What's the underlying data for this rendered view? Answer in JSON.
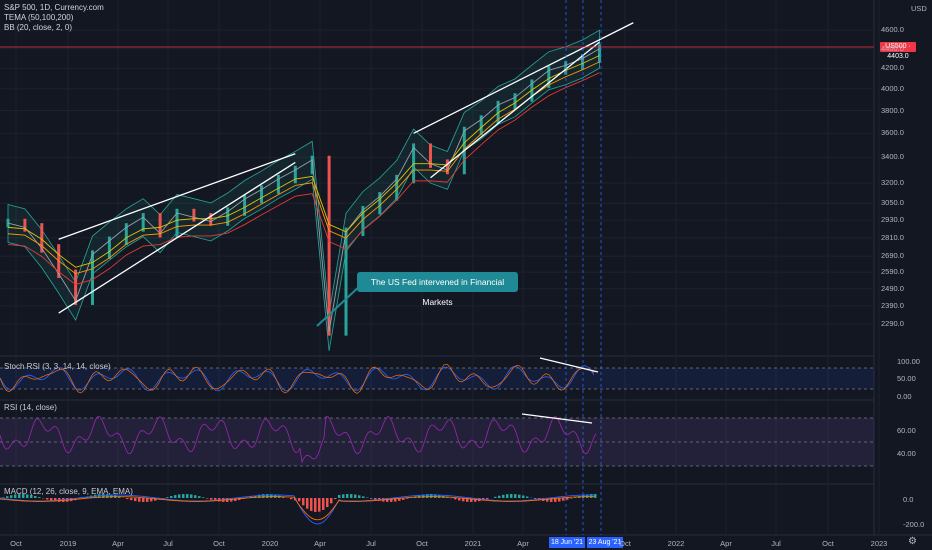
{
  "header": {
    "symbol_line": "S&P 500, 1D, Currency.com",
    "indicator_1": "TEMA (50,100,200)",
    "indicator_2": "BB (20, close, 2, 0)",
    "currency": "USD"
  },
  "price_tag": {
    "label": "US500",
    "value": "4403.0",
    "color": "#f23645"
  },
  "annotation": {
    "text": "The US Fed intervened in Financial Markets",
    "color": "#1f8a95"
  },
  "date_markers": [
    "18 Jun '21",
    "23 Aug '21"
  ],
  "panes": {
    "stoch": {
      "title": "Stoch RSI (3, 3, 14, 14, close)",
      "ticks": [
        "100.00",
        "50.00",
        "0.00"
      ]
    },
    "rsi": {
      "title": "RSI (14, close)",
      "ticks": [
        "60.00",
        "40.00"
      ]
    },
    "macd": {
      "title": "MACD (12, 26, close, 9, EMA, EMA)",
      "ticks": [
        "0.0",
        "-200.0"
      ]
    }
  },
  "colors": {
    "background": "#131722",
    "price_line": "#f23645",
    "stoch": "#7e57c2",
    "rsi": "#9c27b0",
    "date_marker": "#2962ff"
  },
  "chart_data": [
    {
      "type": "line",
      "title": "S&P 500, 1D, Currency.com",
      "x_axis_ticks": [
        "Oct",
        "2019",
        "Apr",
        "Jul",
        "Oct",
        "2020",
        "Apr",
        "Jul",
        "Oct",
        "2021",
        "Apr",
        "Oct",
        "2022",
        "Apr",
        "Jul",
        "Oct",
        "2023"
      ],
      "y_axis_ticks": [
        4600,
        4400,
        4200,
        4000,
        3800,
        3600,
        3400,
        3200,
        3050,
        2930,
        2810,
        2690,
        2590,
        2490,
        2390,
        2290
      ],
      "y_scale": "log",
      "ylim": [
        2200,
        4700
      ],
      "x": [
        "2018-09",
        "2018-10",
        "2018-11",
        "2018-12",
        "2019-01",
        "2019-02",
        "2019-03",
        "2019-04",
        "2019-05",
        "2019-06",
        "2019-07",
        "2019-08",
        "2019-09",
        "2019-10",
        "2019-11",
        "2019-12",
        "2020-01",
        "2020-02",
        "2020-03",
        "2020-04",
        "2020-05",
        "2020-06",
        "2020-07",
        "2020-08",
        "2020-09",
        "2020-10",
        "2020-11",
        "2020-12",
        "2021-01",
        "2021-02",
        "2021-03",
        "2021-04",
        "2021-05",
        "2021-06",
        "2021-07",
        "2021-08"
      ],
      "series": [
        {
          "values": [
            2910,
            2880,
            2740,
            2580,
            2420,
            2700,
            2790,
            2880,
            2950,
            2840,
            2980,
            2950,
            2920,
            2990,
            3080,
            3150,
            3230,
            3300,
            3380,
            2250,
            2850,
            3000,
            3100,
            3230,
            3480,
            3350,
            3300,
            3620,
            3720,
            3850,
            3920,
            4050,
            4180,
            4230,
            4300,
            4400
          ]
        },
        {
          "name": "TEMA (50,100,200)",
          "values": [
            2880,
            2870,
            2800,
            2700,
            2620,
            2650,
            2720,
            2810,
            2870,
            2880,
            2930,
            2940,
            2940,
            2960,
            3020,
            3090,
            3160,
            3230,
            3250,
            2900,
            2850,
            2980,
            3080,
            3200,
            3350,
            3350,
            3340,
            3520,
            3650,
            3780,
            3870,
            3990,
            4100,
            4180,
            4250,
            4330
          ]
        }
      ],
      "trendlines": [
        {
          "from": [
            "2018-12",
            2800
          ],
          "to": [
            "2020-02",
            3430
          ]
        },
        {
          "from": [
            "2018-12",
            2350
          ],
          "to": [
            "2020-02",
            3360
          ]
        },
        {
          "from": [
            "2020-09",
            3600
          ],
          "to": [
            "2021-10",
            4680
          ]
        },
        {
          "from": [
            "2020-10",
            3240
          ],
          "to": [
            "2021-08",
            4470
          ]
        }
      ]
    },
    {
      "type": "line",
      "title": "Stoch RSI (3, 3, 14, 14, close)",
      "ylim": [
        0,
        100
      ],
      "y_axis_ticks": [
        100,
        50,
        0
      ],
      "bands": [
        80,
        20
      ]
    },
    {
      "type": "line",
      "title": "RSI (14, close)",
      "ylim": [
        20,
        85
      ],
      "y_axis_ticks": [
        60,
        40
      ],
      "bands": [
        70,
        30
      ]
    },
    {
      "type": "bar",
      "title": "MACD (12, 26, close, 9, EMA, EMA)",
      "y_axis_ticks": [
        0,
        -200
      ]
    }
  ]
}
